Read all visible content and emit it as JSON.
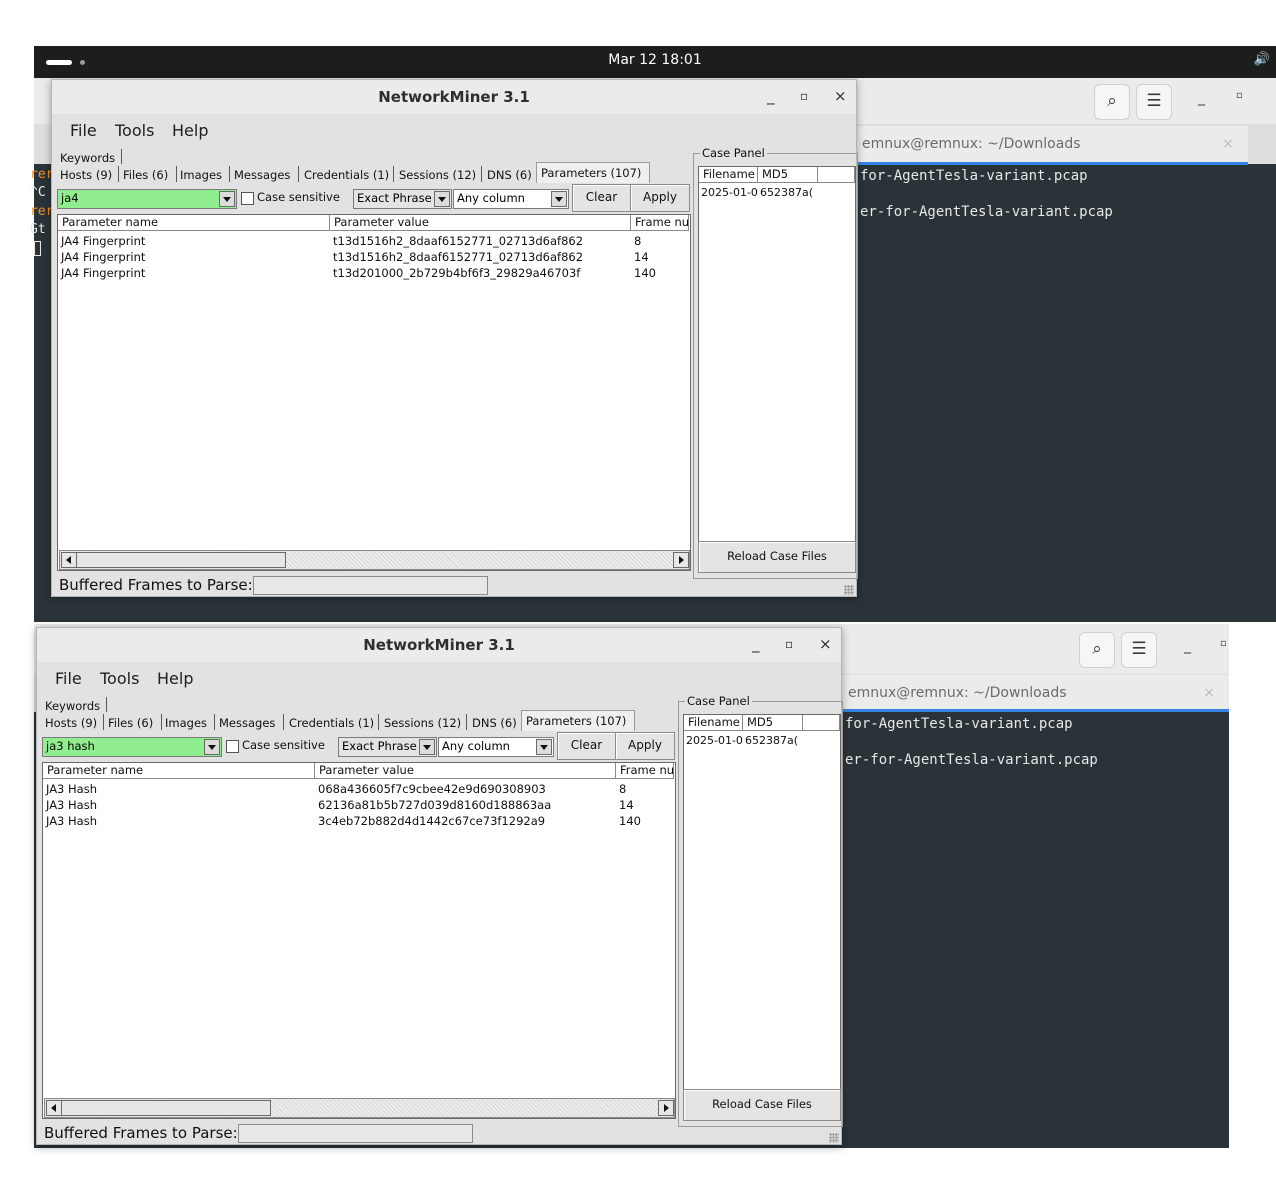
{
  "topbar": {
    "clock": "Mar 12  18:01",
    "speaker_icon": "volume-icon"
  },
  "terminal_top": {
    "tab_title": "emnux@remnux: ~/Downloads",
    "lines": [
      "for-AgentTesla-variant.pcap",
      "er-for-AgentTesla-variant.pcap"
    ],
    "left_fragments": [
      "rer",
      "^C",
      "rer",
      "Gt"
    ]
  },
  "terminal_bottom": {
    "tab_title": "emnux@remnux: ~/Downloads",
    "lines": [
      "for-AgentTesla-variant.pcap",
      "er-for-AgentTesla-variant.pcap"
    ]
  },
  "window_controls": {
    "minimize": "_",
    "maximize": "▫",
    "close": "×"
  },
  "nm_common": {
    "title": "NetworkMiner 3.1",
    "menu": [
      "File",
      "Tools",
      "Help"
    ],
    "keywords_tab": "Keywords",
    "tabs": [
      "Hosts (9)",
      "Files (6)",
      "Images",
      "Messages",
      "Credentials (1)",
      "Sessions (12)",
      "DNS (6)",
      "Parameters (107)"
    ],
    "case_sensitive": "Case sensitive",
    "match_mode": "Exact Phrase",
    "column_scope": "Any column",
    "clear": "Clear",
    "apply": "Apply",
    "columns": [
      "Parameter name",
      "Parameter value",
      "Frame nu"
    ],
    "case_panel": {
      "label": "Case Panel",
      "columns": [
        "Filename",
        "MD5"
      ],
      "row": [
        "2025-01-0",
        "652387a("
      ],
      "reload": "Reload Case Files"
    },
    "status_label": "Buffered Frames to Parse:"
  },
  "nm_top": {
    "filter_text": "ja4",
    "rows": [
      {
        "name": "JA4 Fingerprint",
        "value": "t13d1516h2_8daaf6152771_02713d6af862",
        "frame": "8"
      },
      {
        "name": "JA4 Fingerprint",
        "value": "t13d1516h2_8daaf6152771_02713d6af862",
        "frame": "14"
      },
      {
        "name": "JA4 Fingerprint",
        "value": "t13d201000_2b729b4bf6f3_29829a46703f",
        "frame": "140"
      }
    ]
  },
  "nm_bottom": {
    "filter_text": "ja3 hash",
    "rows": [
      {
        "name": "JA3 Hash",
        "value": "068a436605f7c9cbee42e9d690308903",
        "frame": "8"
      },
      {
        "name": "JA3 Hash",
        "value": "62136a81b5b727d039d8160d188863aa",
        "frame": "14"
      },
      {
        "name": "JA3 Hash",
        "value": "3c4eb72b882d4d1442c67ce73f1292a9",
        "frame": "140"
      }
    ]
  }
}
